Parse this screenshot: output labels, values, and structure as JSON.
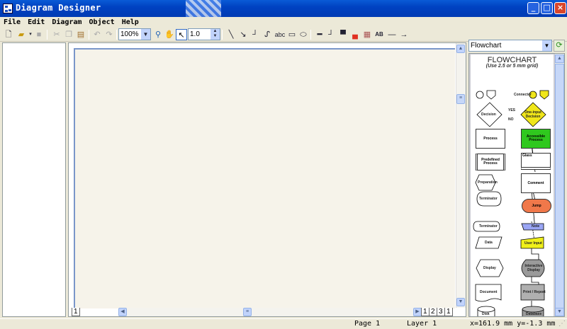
{
  "window": {
    "title": "Diagram Designer"
  },
  "menu": [
    {
      "label": "File",
      "name": "menu-file"
    },
    {
      "label": "Edit",
      "name": "menu-edit"
    },
    {
      "label": "Diagram",
      "name": "menu-diagram"
    },
    {
      "label": "Object",
      "name": "menu-object"
    },
    {
      "label": "Help",
      "name": "menu-help"
    }
  ],
  "toolbar": {
    "zoom": "100%",
    "line_width": "1.0",
    "text_tool": "abc",
    "text_style": "AB"
  },
  "page_tabs": [
    "1",
    "1",
    "2",
    "3",
    "1"
  ],
  "shape_panel": {
    "category": "Flowchart",
    "heading": "FLOWCHART",
    "subheading": "(Use 2.5 or 5 mm grid)",
    "labels": {
      "connector": "Connector",
      "yes": "YES",
      "no": "NO",
      "decision": "Decision",
      "oneinput": "One-input Decision",
      "process": "Process",
      "accessible": "Accessible Process",
      "predefined": "Predefined Process",
      "glass": "Glass",
      "preparation": "Preparation",
      "comment": "Comment",
      "terminator1": "Terminator",
      "jump": "Jump",
      "terminator2": "Terminator",
      "note": "Note",
      "data": "Data",
      "userinput": "User Input",
      "display": "Display",
      "interactive": "Interactive Display",
      "document": "Document",
      "print": "Print / Report",
      "disk": "Disk",
      "database": "Database"
    }
  },
  "status": {
    "page": "Page 1",
    "layer": "Layer 1",
    "coords": "x=161.9 mm  y=-1.3 mm"
  },
  "colors": {
    "accessible": "#2fc81e",
    "oneinput": "#f0e61a",
    "jump": "#f0784a",
    "note": "#9aa6f5",
    "userinput": "#f0f01a",
    "interactive": "#9a9a9a",
    "print": "#b0b0b0",
    "database": "#9a9a9a"
  }
}
